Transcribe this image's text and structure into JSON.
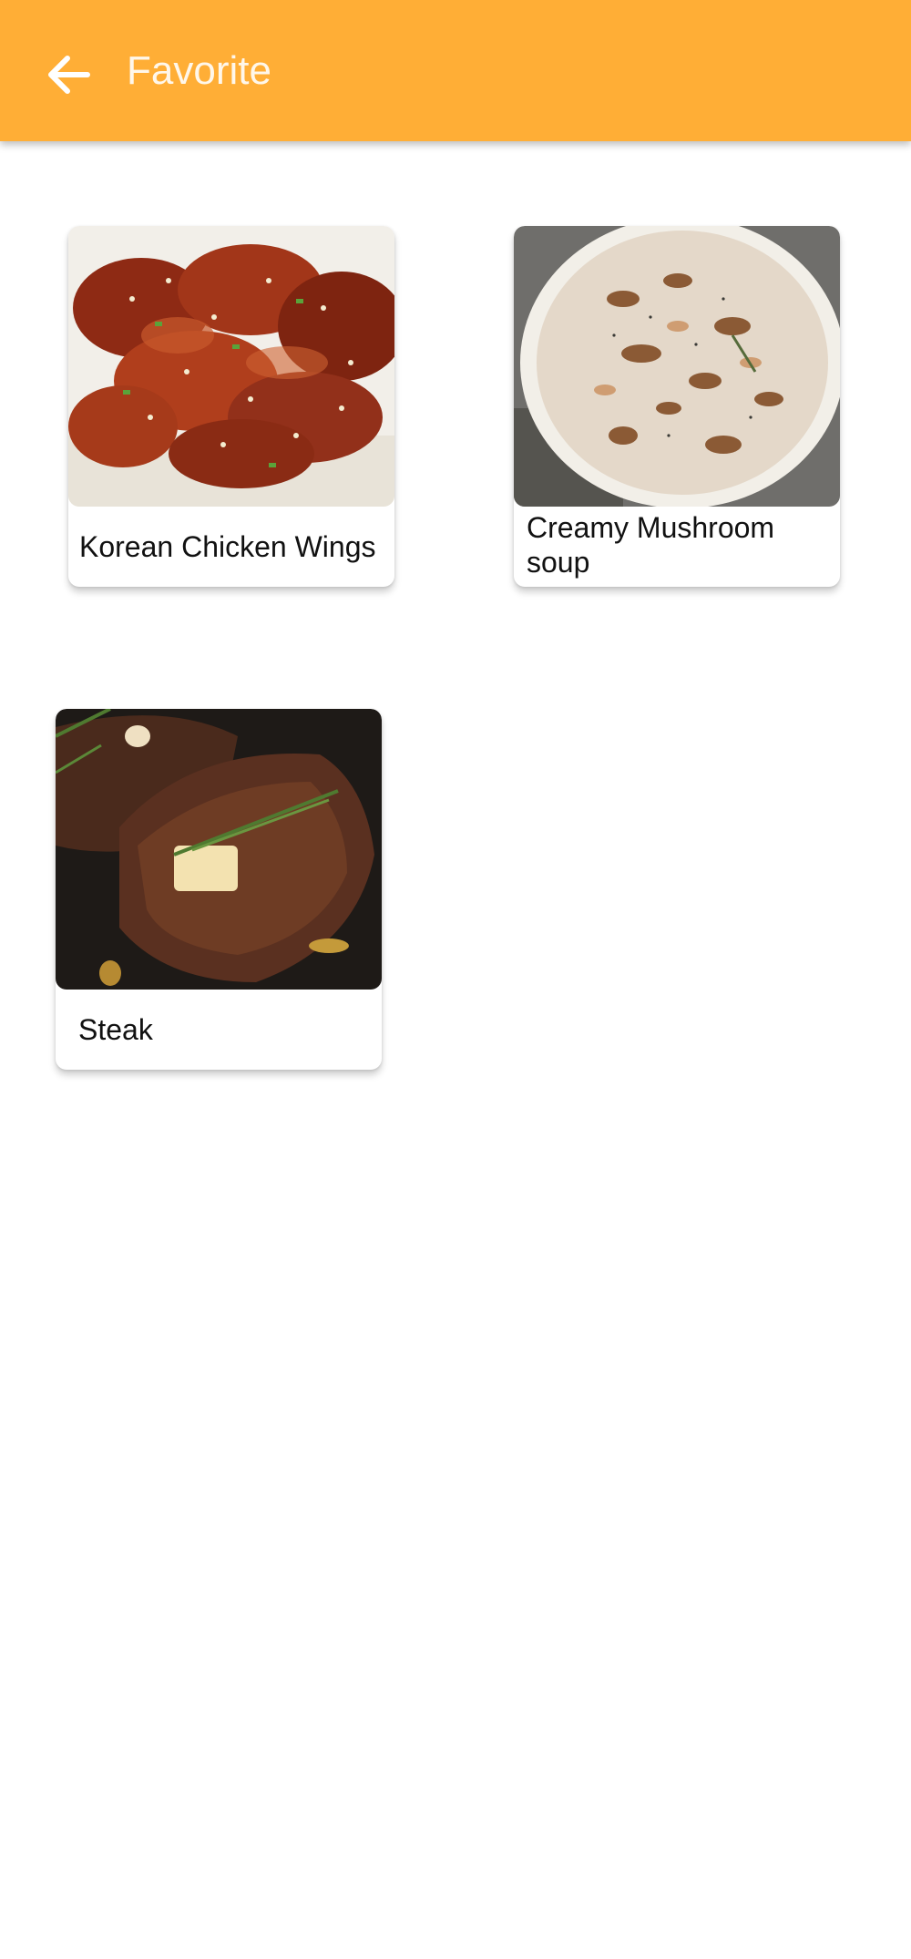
{
  "appbar": {
    "title": "Favorite",
    "back_icon": "arrow-left-icon",
    "background_color": "#FFAE36"
  },
  "favorites": [
    {
      "name": "Korean Chicken Wings",
      "image": "chicken-wings-photo"
    },
    {
      "name": "Creamy Mushroom soup",
      "image": "mushroom-soup-photo"
    },
    {
      "name": "Steak",
      "image": "steak-photo"
    }
  ]
}
